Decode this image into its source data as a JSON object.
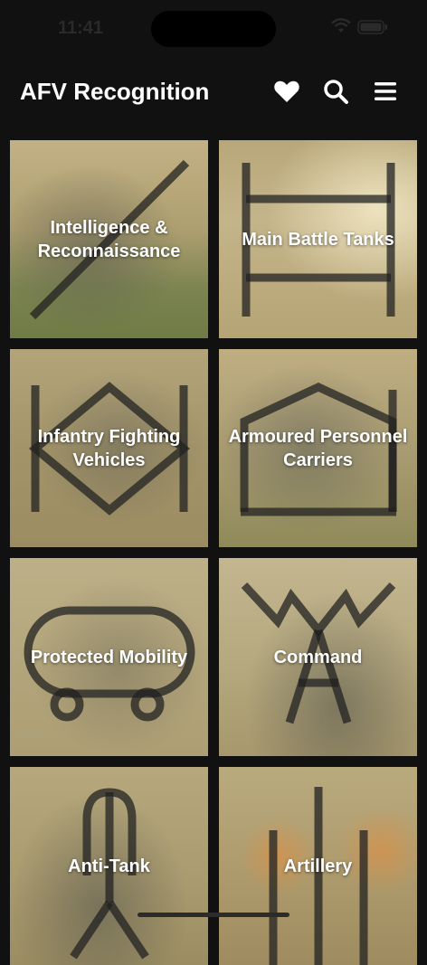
{
  "status_bar": {
    "time": "11:41"
  },
  "header": {
    "title": "AFV Recognition",
    "icons": [
      "heart-icon",
      "search-icon",
      "menu-icon"
    ]
  },
  "categories": [
    {
      "label": "Intelligence & Reconnaissance",
      "symbol": "diagonal-line"
    },
    {
      "label": "Main Battle Tanks",
      "symbol": "track-frame"
    },
    {
      "label": "Infantry Fighting Vehicles",
      "symbol": "diamond-bars"
    },
    {
      "label": "Armoured Personnel Carriers",
      "symbol": "house-frame"
    },
    {
      "label": "Protected Mobility",
      "symbol": "wheeled-oval"
    },
    {
      "label": "Command",
      "symbol": "lightning-a"
    },
    {
      "label": "Anti-Tank",
      "symbol": "inverted-y"
    },
    {
      "label": "Artillery",
      "symbol": "vertical-bars"
    }
  ],
  "colors": {
    "background": "#111111",
    "tile_overlay": "#c8b47a",
    "symbol": "#222222",
    "text": "#ffffff"
  }
}
